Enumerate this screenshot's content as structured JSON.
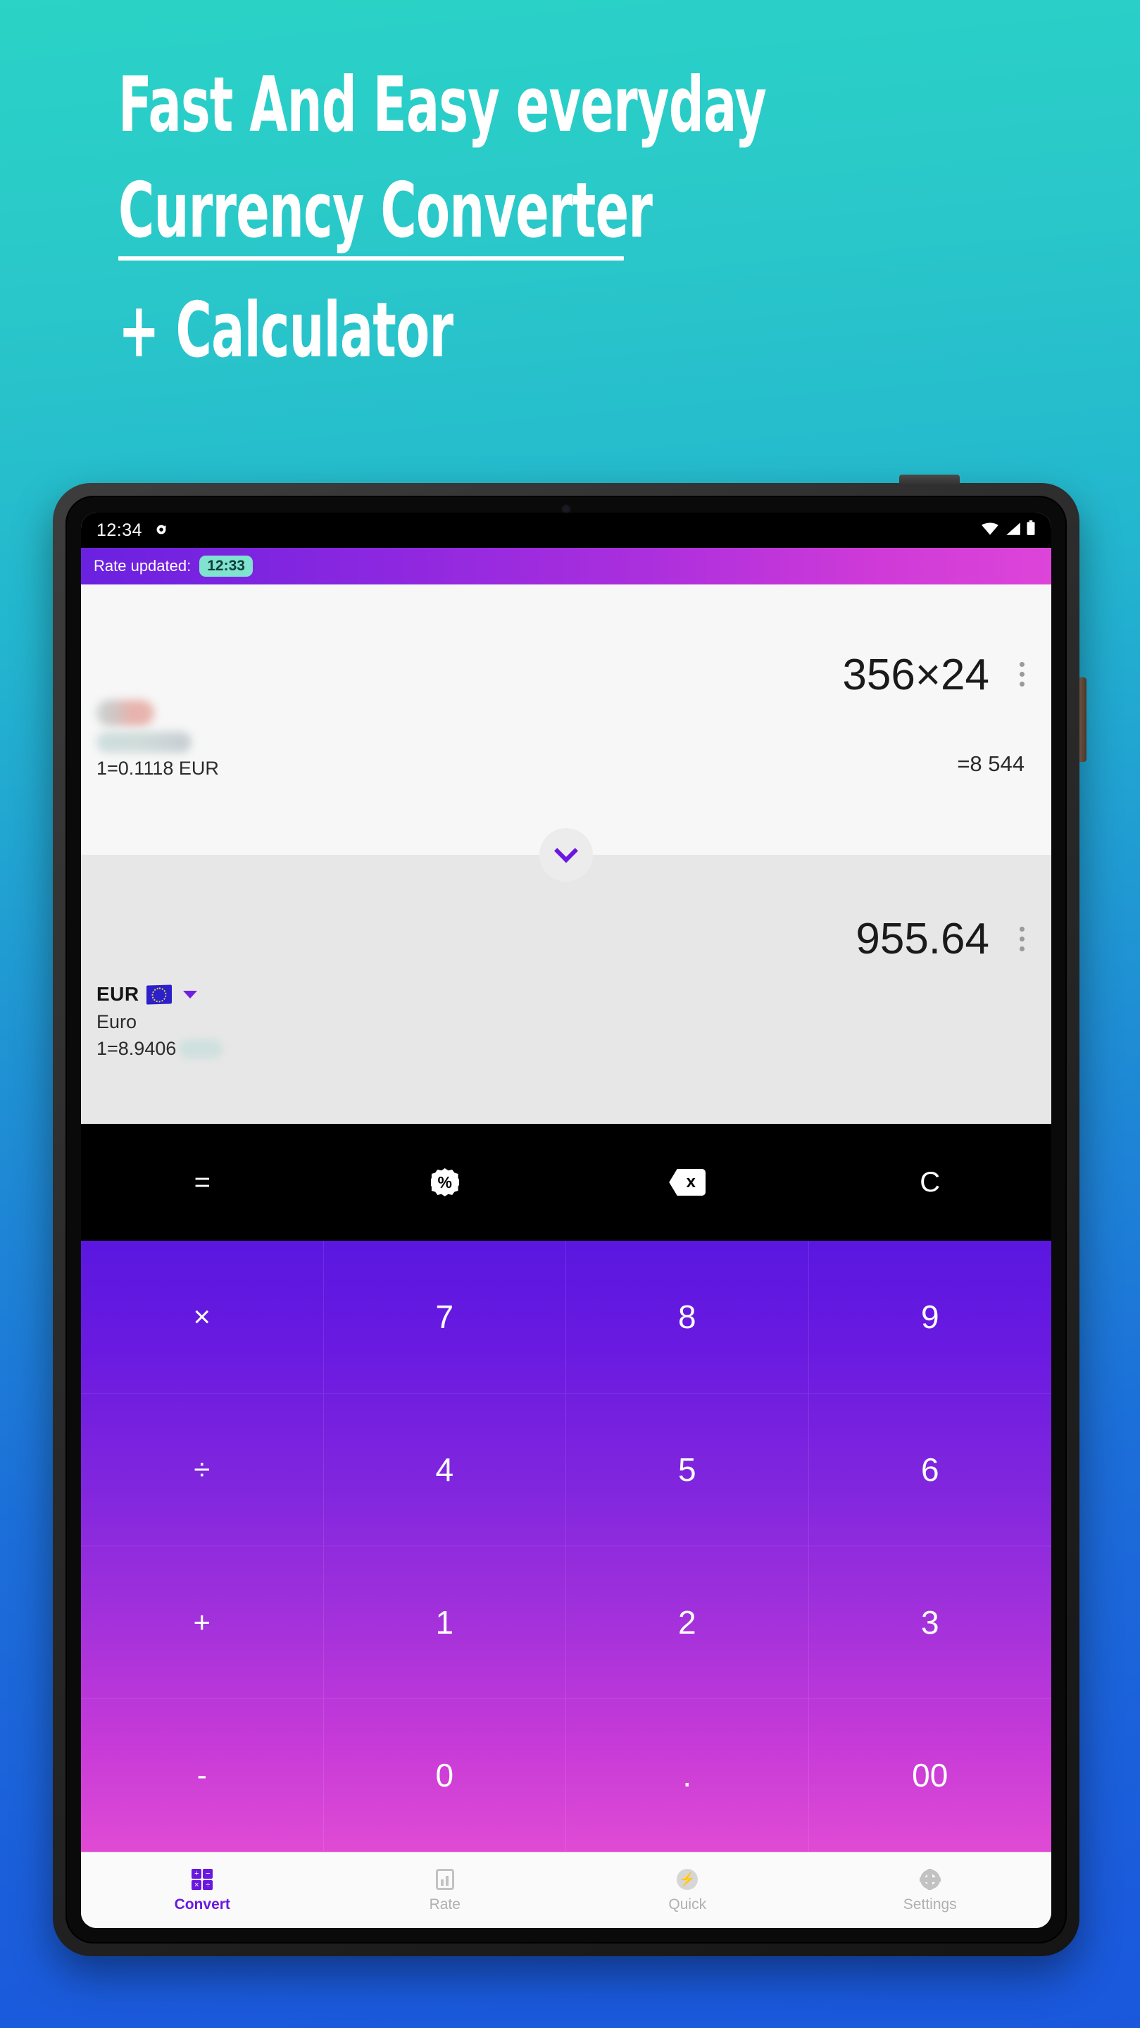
{
  "promo": {
    "line1": "Fast And Easy everyday",
    "line2": "Currency Converter",
    "line3": "+ Calculator"
  },
  "device": {
    "statusbar": {
      "time": "12:34",
      "left_icon": "notification-icon",
      "wifi_icon": "wifi-icon",
      "signal_icon": "signal-icon",
      "battery_icon": "battery-icon"
    },
    "ratebar": {
      "label": "Rate updated:",
      "badge": "12:33",
      "gradient_from": "#6a21e0",
      "gradient_to": "#dd45d9"
    },
    "conversion": {
      "from": {
        "code": "",
        "name": "",
        "rate": "1=0.1118 EUR",
        "amount": "356×24",
        "result": "=8 544",
        "menu_icon": "kebab-menu-icon"
      },
      "swap_icon": "chevron-down-icon",
      "to": {
        "code": "EUR",
        "name": "Euro",
        "rate_prefix": "1=8.9406",
        "amount": "955.64",
        "flag_icon": "eu-flag-icon",
        "dropdown_icon": "caret-down-icon",
        "menu_icon": "kebab-menu-icon"
      }
    },
    "functions": [
      {
        "label": "=",
        "icon": "equals-icon"
      },
      {
        "label": "%",
        "icon": "percent-badge-icon"
      },
      {
        "label": "x",
        "icon": "backspace-icon"
      },
      {
        "label": "C",
        "icon": "clear-icon"
      }
    ],
    "keypad": [
      "×",
      "7",
      "8",
      "9",
      "÷",
      "4",
      "5",
      "6",
      "+",
      "1",
      "2",
      "3",
      "-",
      "0",
      ".",
      "00"
    ],
    "bottomnav": [
      {
        "label": "Convert",
        "icon": "calculator-icon",
        "active": true
      },
      {
        "label": "Rate",
        "icon": "chart-icon",
        "active": false
      },
      {
        "label": "Quick",
        "icon": "bolt-icon",
        "active": false
      },
      {
        "label": "Settings",
        "icon": "gear-icon",
        "active": false
      }
    ],
    "calc_icon_glyphs": [
      "+",
      "−",
      "×",
      "÷"
    ],
    "colors": {
      "accent_purple": "#6a18e0",
      "accent_pink": "#dd45d9",
      "badge_teal": "#7fe3d0",
      "bg_teal": "#2ad3c6",
      "bg_blue": "#1a57dc"
    }
  }
}
